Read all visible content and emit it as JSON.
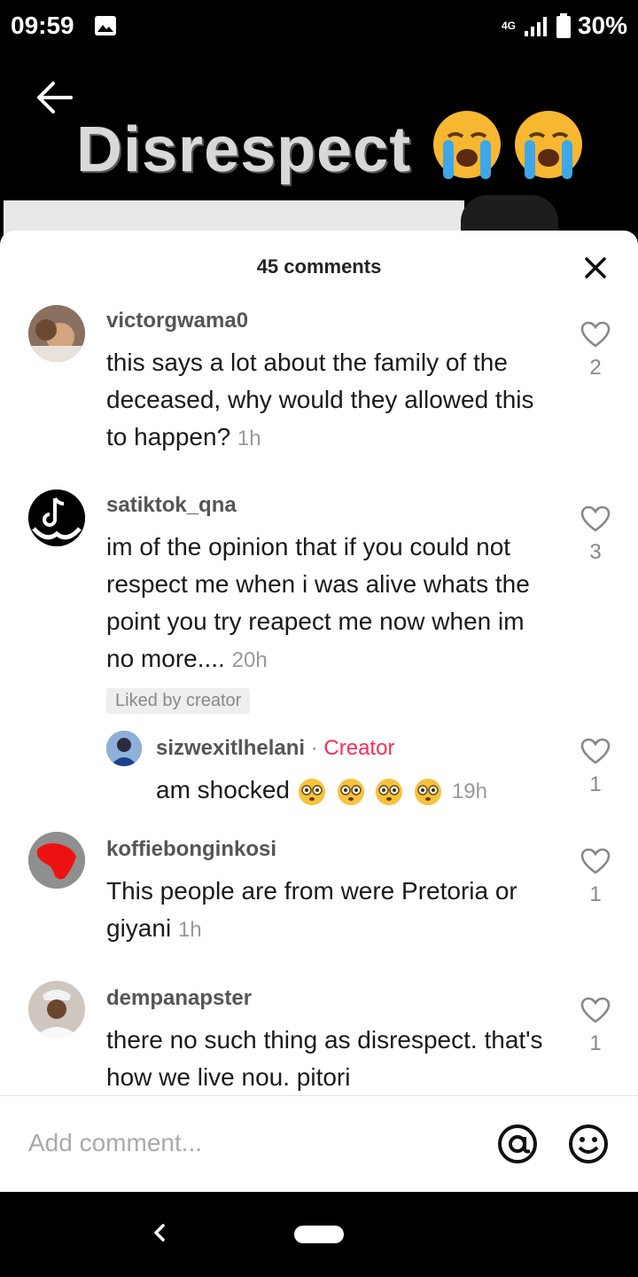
{
  "status_bar": {
    "time": "09:59",
    "network": "4G",
    "battery": "30%"
  },
  "video": {
    "title": "Disrespect"
  },
  "comments_sheet": {
    "title": "45 comments",
    "comments": [
      {
        "username": "victorgwama0",
        "text": "this says a lot about the family of the deceased, why would they allowed this to happen?",
        "time": "1h",
        "likes": "2"
      },
      {
        "username": "satiktok_qna",
        "text": "im of the opinion that if you could not respect me when i was alive whats the point you try reapect me now when im no more....",
        "time": "20h",
        "likes": "3",
        "badge": "Liked by creator"
      },
      {
        "username": "sizwexitlhelani",
        "tag": "Creator",
        "text": "am shocked",
        "time": "19h",
        "likes": "1"
      },
      {
        "username": "koffiebonginkosi",
        "text": "This people are from were Pretoria or giyani",
        "time": "1h",
        "likes": "1"
      },
      {
        "username": "dempanapster",
        "text": "there no such thing as disrespect. that's how we live nou. pitori",
        "likes": "1"
      }
    ]
  },
  "input": {
    "placeholder": "Add comment..."
  },
  "colors": {
    "creator_tag": "#fe2c55",
    "sheet_bg": "#ffffff",
    "bar_bg": "#000000"
  }
}
